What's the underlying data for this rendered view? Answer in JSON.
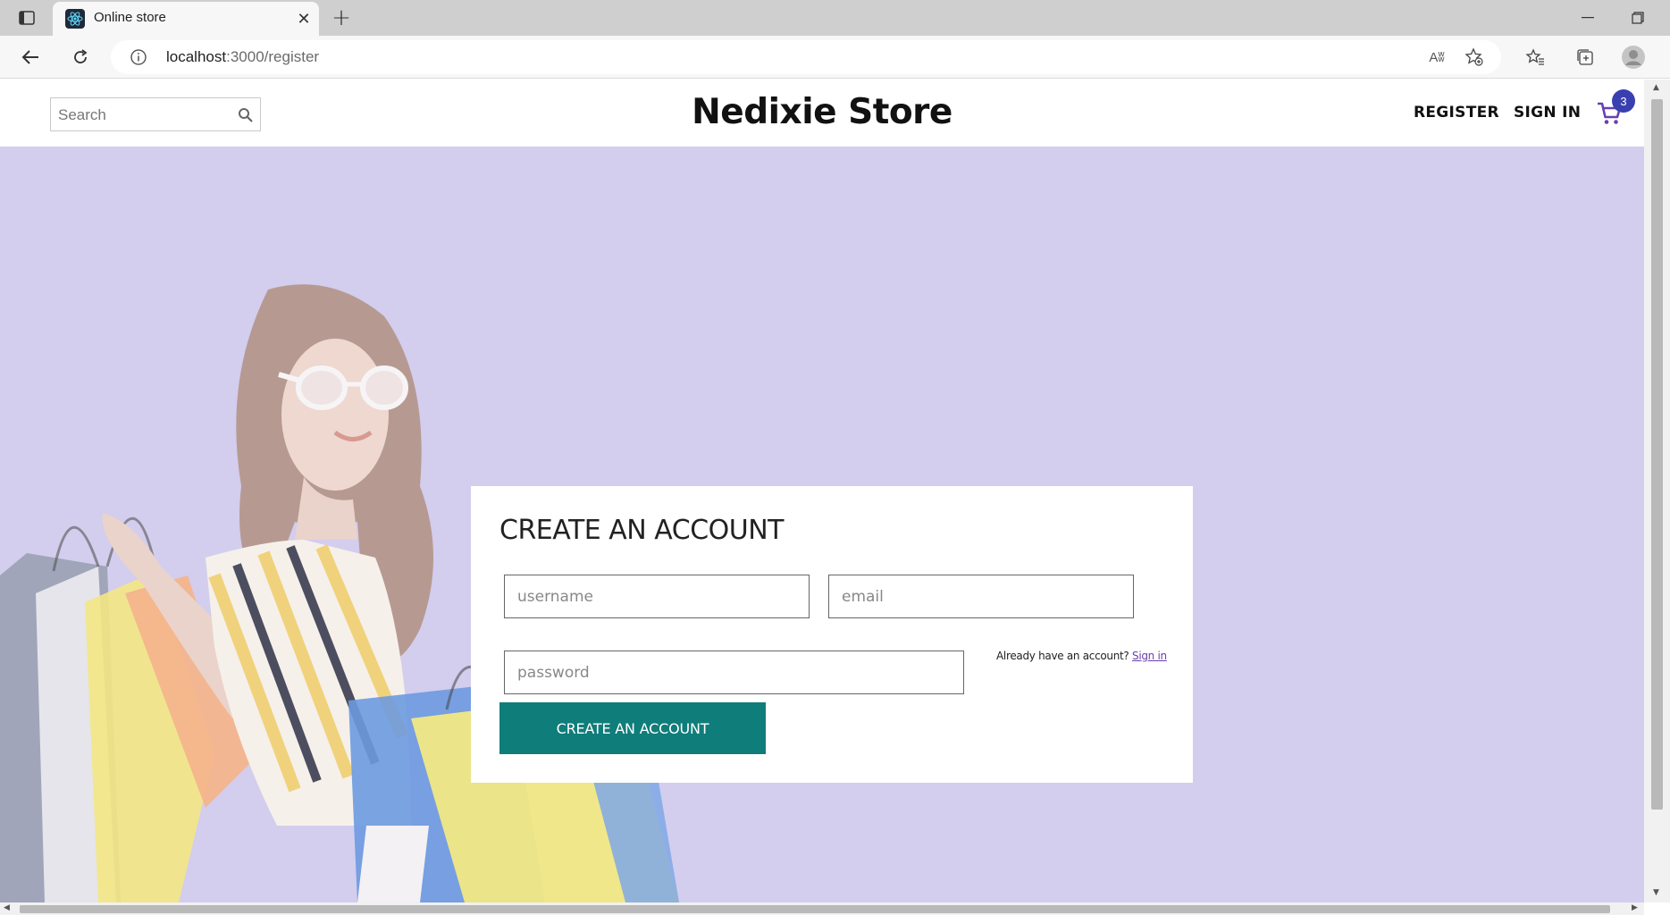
{
  "browser": {
    "tab_title": "Online store",
    "url_host": "localhost",
    "url_path": ":3000/register",
    "read_aloud_label": "Aʬ"
  },
  "navbar": {
    "search_placeholder": "Search",
    "brand": "Nedixie Store",
    "register_label": "REGISTER",
    "signin_label": "SIGN IN",
    "cart_count": "3"
  },
  "form": {
    "title": "CREATE AN ACCOUNT",
    "username_placeholder": "username",
    "email_placeholder": "email",
    "password_placeholder": "password",
    "signin_prompt": "Already have an account? ",
    "signin_link": "Sign in",
    "submit_label": "CREATE AN ACCOUNT"
  },
  "colors": {
    "page_background": "#d3cdee",
    "submit_button": "#0f7d7a",
    "cart_badge": "#3a3fb0",
    "cart_icon": "#6a3fb0"
  }
}
